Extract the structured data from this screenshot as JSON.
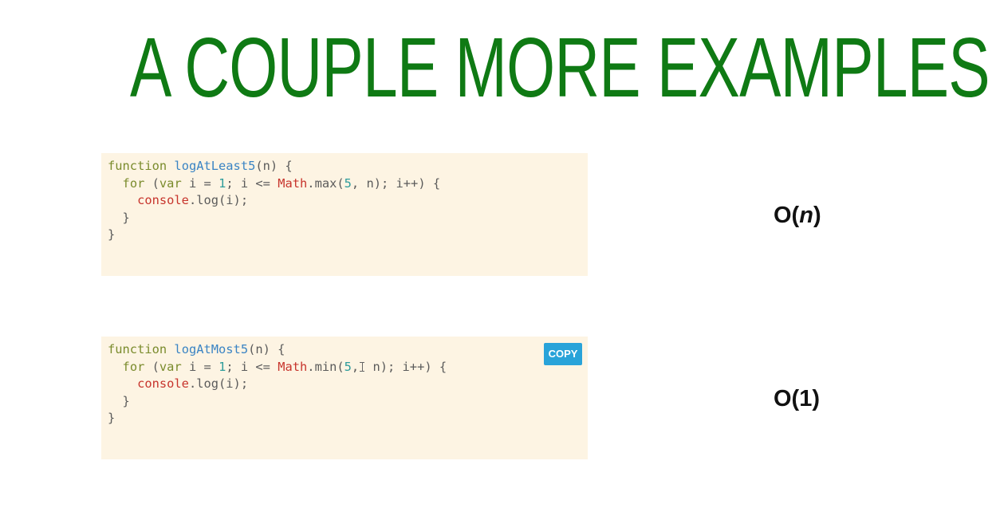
{
  "slide": {
    "title": "A COUPLE MORE EXAMPLES"
  },
  "examples": [
    {
      "lines": [
        [
          "function",
          " ",
          "logAtLeast5",
          "(n) {"
        ],
        [
          "  ",
          "for",
          " (",
          "var",
          " i = ",
          "1",
          "; i <= ",
          "Math",
          ".max(",
          "5",
          ", n); i++) {"
        ],
        [
          "    ",
          "console",
          ".log(i);"
        ],
        [
          "  }"
        ],
        [
          "}"
        ]
      ],
      "complexity_prefix": "O(",
      "complexity_var": "n",
      "complexity_suffix": ")"
    },
    {
      "lines": [
        [
          "function",
          " ",
          "logAtMost5",
          "(n) {"
        ],
        [
          "  ",
          "for",
          " (",
          "var",
          " i = ",
          "1",
          "; i <= ",
          "Math",
          ".min(",
          "5",
          ",",
          " n); i++) {"
        ],
        [
          "    ",
          "console",
          ".log(i);"
        ],
        [
          "  }"
        ],
        [
          "}"
        ]
      ],
      "copy_label": "COPY",
      "complexity": "O(1)"
    }
  ],
  "colors": {
    "title": "#0f7a14",
    "code_background": "#fdf4e3",
    "keyword": "#7a8b2c",
    "function_name": "#3a84c4",
    "object": "#c7342c",
    "number": "#2d9c9b",
    "copy_button": "#29a3d9"
  },
  "icons": {
    "text_cursor": "i-beam-cursor-icon"
  }
}
